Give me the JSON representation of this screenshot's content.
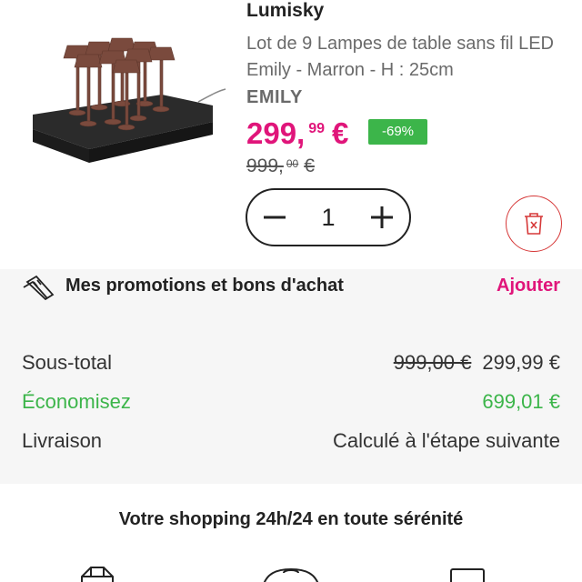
{
  "product": {
    "brand": "Lumisky",
    "title": "Lot de 9 Lampes de table sans fil LED Emily - Marron - H : 25cm",
    "model": "EMILY",
    "price": {
      "integer": "299,",
      "decimals": "99",
      "currency": "€"
    },
    "discount": "-69%",
    "old_price": {
      "integer": "999,",
      "decimals": "00",
      "currency": "€"
    },
    "quantity": "1",
    "image_alt": "9 brown table lamps on black charging base"
  },
  "promo": {
    "label": "Mes promotions et bons d'achat",
    "action": "Ajouter"
  },
  "summary": {
    "subtotal_label": "Sous-total",
    "subtotal_old": "999,00 €",
    "subtotal_value": "299,99 €",
    "savings_label": "Économisez",
    "savings_value": "699,01 €",
    "shipping_label": "Livraison",
    "shipping_value": "Calculé à l'étape suivante"
  },
  "banner": {
    "title": "Votre shopping 24h/24 en toute sérénité"
  },
  "colors": {
    "accent": "#e0157a",
    "discount": "#3cb54a",
    "delete": "#d63838"
  },
  "icons": [
    "minus-icon",
    "plus-icon",
    "trash-icon",
    "coupon-icon",
    "truck-icon",
    "headset-icon",
    "card-icon"
  ]
}
